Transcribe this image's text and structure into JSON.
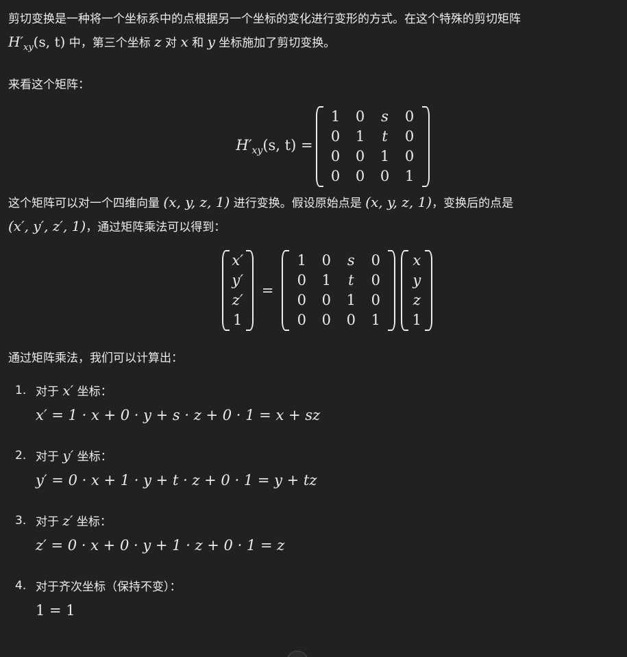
{
  "intro": {
    "t1": "剪切变换是一种将一个坐标系中的点根据另一个坐标的变化进行变形的方式。在这个特殊的剪切矩阵",
    "hname": "H′",
    "hsub": "xy",
    "hargs": "(s, t)",
    "t2": " 中，第三个坐标 ",
    "z": "z",
    "t3": " 对 ",
    "x": "x",
    "t4": " 和 ",
    "y": "y",
    "t5": " 坐标施加了剪切变换。"
  },
  "look": "来看这个矩阵：",
  "matrix_eq": {
    "lhs_name": "H′",
    "lhs_sub": "xy",
    "lhs_args": "(s, t) =",
    "rows": [
      [
        "1",
        "0",
        "s",
        "0"
      ],
      [
        "0",
        "1",
        "t",
        "0"
      ],
      [
        "0",
        "0",
        "1",
        "0"
      ],
      [
        "0",
        "0",
        "0",
        "1"
      ]
    ]
  },
  "para2": {
    "t1": "这个矩阵可以对一个四维向量 ",
    "v1": "(x, y, z, 1)",
    "t2": " 进行变换。假设原始点是 ",
    "v2": "(x, y, z, 1)",
    "t3": "，变换后的点是",
    "v3": "(x′, y′, z′, 1)",
    "t4": "，通过矩阵乘法可以得到："
  },
  "mult_eq": {
    "lhs": [
      "x′",
      "y′",
      "z′",
      "1"
    ],
    "eq": "=",
    "rows": [
      [
        "1",
        "0",
        "s",
        "0"
      ],
      [
        "0",
        "1",
        "t",
        "0"
      ],
      [
        "0",
        "0",
        "1",
        "0"
      ],
      [
        "0",
        "0",
        "0",
        "1"
      ]
    ],
    "rhs": [
      "x",
      "y",
      "z",
      "1"
    ]
  },
  "para3": "通过矩阵乘法，我们可以计算出：",
  "items": [
    {
      "num": "1.",
      "pre": "对于 ",
      "var": "x′",
      "post": " 坐标：",
      "calc": "x′ = 1 · x + 0 · y + s · z + 0 · 1 = x + sz"
    },
    {
      "num": "2.",
      "pre": "对于 ",
      "var": "y′",
      "post": " 坐标：",
      "calc": "y′ = 0 · x + 1 · y + t · z + 0 · 1 = y + tz"
    },
    {
      "num": "3.",
      "pre": "对于 ",
      "var": "z′",
      "post": " 坐标：",
      "calc": "z′ = 0 · x + 0 · y + 1 · z + 0 · 1 = z"
    },
    {
      "num": "4.",
      "pre": "对于齐次坐标（保持不变）：",
      "var": "",
      "post": "",
      "calc": "1 = 1"
    }
  ]
}
